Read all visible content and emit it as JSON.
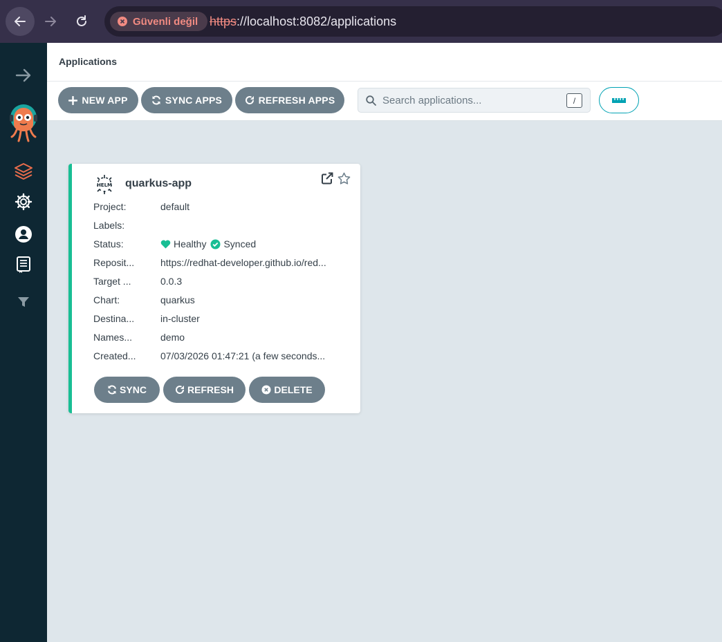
{
  "browser": {
    "security_label": "Güvenli değil",
    "url_scheme": "https",
    "url_rest": "://localhost:8082/applications"
  },
  "sidebar": {
    "icons": [
      "arrow-right-icon",
      "argo-logo",
      "layers-icon",
      "settings-gear-icon",
      "user-icon",
      "docs-icon",
      "filter-icon"
    ]
  },
  "header": {
    "title": "Applications"
  },
  "toolbar": {
    "new_app": "NEW APP",
    "sync_apps": "SYNC APPS",
    "refresh_apps": "REFRESH APPS",
    "search_placeholder": "Search applications...",
    "search_shortcut": "/"
  },
  "app": {
    "name": "quarkus-app",
    "fields": [
      {
        "key": "Project:",
        "value": "default"
      },
      {
        "key": "Labels:",
        "value": ""
      },
      {
        "key": "Status:",
        "health": "Healthy",
        "sync": "Synced"
      },
      {
        "key": "Reposit...",
        "value": "https://redhat-developer.github.io/red..."
      },
      {
        "key": "Target ...",
        "value": "0.0.3"
      },
      {
        "key": "Chart:",
        "value": "quarkus"
      },
      {
        "key": "Destina...",
        "value": "in-cluster"
      },
      {
        "key": "Names...",
        "value": "demo"
      },
      {
        "key": "Created...",
        "value": "07/03/2026 01:47:21  (a few seconds..."
      }
    ],
    "actions": {
      "sync": "SYNC",
      "refresh": "REFRESH",
      "delete": "DELETE"
    }
  },
  "colors": {
    "sidebar_bg": "#0e2733",
    "healthy": "#18be94",
    "button_bg": "#6d7f8b",
    "accent": "#00a2b3"
  }
}
